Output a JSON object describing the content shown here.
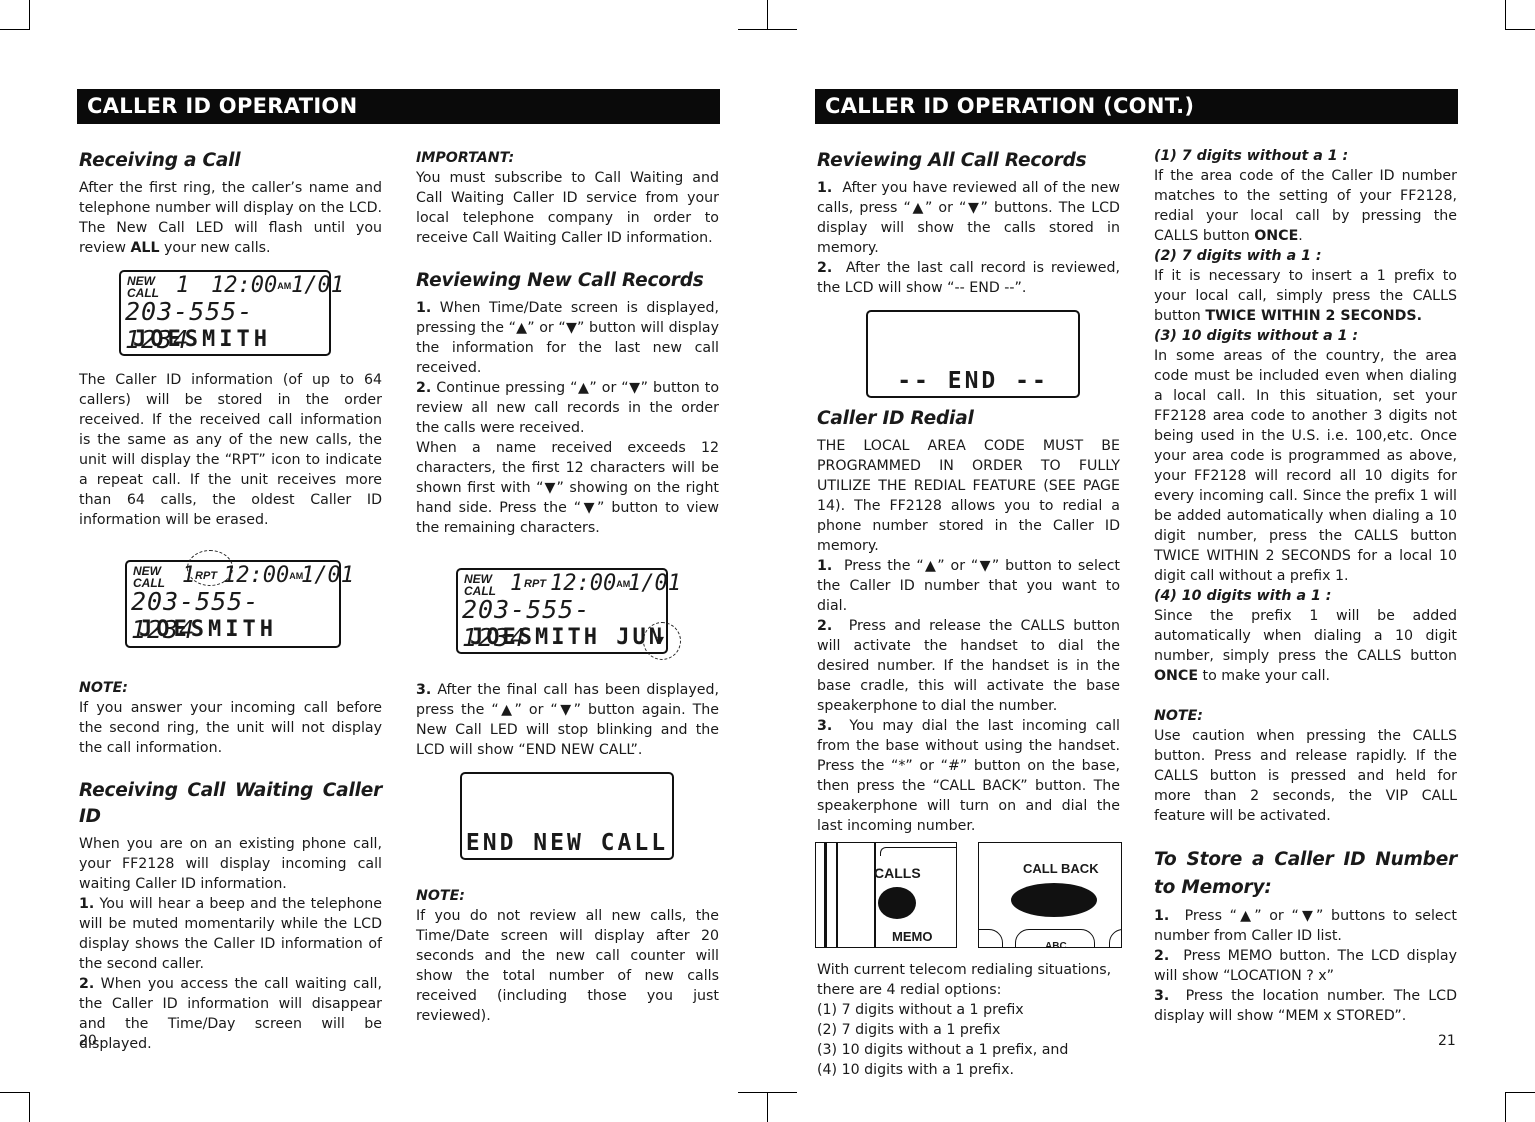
{
  "left_page": {
    "banner": "CALLER ID OPERATION",
    "page_number": "20",
    "col1": {
      "receiving_call": {
        "heading": "Receiving a Call",
        "p1_a": "After the first ring, the caller’s name and telephone number will display on the LCD. The New Call LED will flash until you review ",
        "p1_bold": "ALL",
        "p1_b": " your new calls.",
        "p2": "The Caller ID information (of up to 64 callers) will be stored in the order received. If the received call information is the same as any of the new calls, the unit will display the “RPT” icon to indicate a repeat call. If the unit receives more than 64 calls, the oldest Caller ID information will be erased."
      },
      "lcd1": {
        "new": "NEW",
        "call": "CALL",
        "count": "1",
        "time": "12:00",
        "ampm": "AM",
        "date": "1/01",
        "phone": "203-555- 1234",
        "name": "JOESMITH"
      },
      "lcd2": {
        "new": "NEW",
        "call": "CALL",
        "count": "1",
        "rpt": "RPT",
        "time": "12:00",
        "ampm": "AM",
        "date": "1/01",
        "phone": "203-555- 1234",
        "name": "JOESMITH"
      },
      "note": {
        "label": "NOTE:",
        "text": "If you answer your incoming call before the second ring, the unit will not display the call information."
      },
      "call_waiting": {
        "heading": "Receiving Call Waiting Caller ID",
        "intro": "When you are on an existing phone call, your FF2128 will display incoming call waiting Caller ID information.",
        "steps": [
          {
            "num": "1.",
            "text": "You will hear a beep and the telephone will be muted momentarily while the LCD display shows the Caller ID information of the second caller."
          },
          {
            "num": "2.",
            "text": "When you access the call waiting call, the Caller ID information will disappear and the Time/Day screen will be displayed."
          }
        ]
      }
    },
    "col2": {
      "important": {
        "label": "IMPORTANT:",
        "text": "You must subscribe to Call Waiting and Call Waiting Caller ID service from your local telephone company in order to receive Call Waiting Caller ID information."
      },
      "reviewing_new": {
        "heading": "Reviewing New Call Records",
        "step1_num": "1.",
        "step1": "When Time/Date screen is displayed, pressing the “▲” or “▼” button will display the information for the last new call received.",
        "step2_num": "2.",
        "step2": "Continue pressing “▲” or “▼” button to review all new call records in the order the calls were received.",
        "p_long": "When a name received exceeds 12 characters, the first 12 characters will be shown first with “▼” showing on the right hand side. Press the “▼” button to view the remaining characters.",
        "step3_num": "3.",
        "step3": "After the final call has been displayed, press the “▲” or “▼” button again. The New Call LED will stop blinking and the LCD will show “END NEW CALL”."
      },
      "lcd3": {
        "new": "NEW",
        "call": "CALL",
        "count": "1",
        "rpt": "RPT",
        "time": "12:00",
        "ampm": "AM",
        "date": "1/01",
        "phone": "203-555- 1234",
        "name": "JOESMITH JUN",
        "arrow": "▾"
      },
      "lcd4": {
        "text": "END NEW CALL"
      },
      "note": {
        "label": "NOTE:",
        "text": "If you do not review all new calls, the Time/Date screen will display after 20 seconds and the new call counter will show the total number of new calls received (including those you just reviewed)."
      }
    }
  },
  "right_page": {
    "banner": "CALLER ID OPERATION (CONT.)",
    "page_number": "21",
    "col3": {
      "reviewing_all": {
        "heading": "Reviewing All Call Records",
        "step1_num": "1.",
        "step1": "After you have reviewed all of the new calls, press “▲” or “▼” buttons. The LCD display will show the calls stored in memory.",
        "step2_num": "2.",
        "step2": "After the last call record is reviewed, the LCD will show “-- END --”."
      },
      "lcd5": {
        "text": "-- END --"
      },
      "redial": {
        "heading": "Caller ID Redial",
        "intro": "THE LOCAL AREA CODE MUST BE PROGRAMMED IN ORDER TO FULLY UTILIZE THE REDIAL FEATURE (SEE PAGE 14). The FF2128 allows you to redial a phone number stored in the Caller ID memory.",
        "steps": [
          {
            "num": "1.",
            "text": "Press the “▲” or “▼” button to select the Caller ID number that you want to dial."
          },
          {
            "num": "2.",
            "text": "Press and release the CALLS button will activate the handset to dial the desired number. If the handset is in the base cradle, this will activate the base speakerphone to dial the number."
          },
          {
            "num": "3.",
            "text": "You may dial the last incoming call from the base without using the handset. Press the “*” or “#” button on the base, then press the “CALL BACK” button. The speakerphone will turn on and dial the last incoming number."
          }
        ]
      },
      "fig_calls": {
        "calls": "CALLS",
        "memo": "MEMO"
      },
      "fig_callback": {
        "callback": "CALL BACK",
        "abc": "ABC"
      },
      "options_intro": "With current telecom redialing situations, there are 4 redial options:",
      "options": [
        "(1)  7 digits without a 1 prefix",
        "(2)  7 digits with a 1 prefix",
        "(3)  10 digits without a 1 prefix, and",
        "(4)  10 digits with a 1 prefix."
      ]
    },
    "col4": {
      "opt1": {
        "label": "(1)  7 digits without a 1 :",
        "text_a": "If the area code of the Caller ID number matches to the setting of your FF2128, redial your local call by pressing the CALLS button ",
        "bold": "ONCE",
        "text_b": "."
      },
      "opt2": {
        "label": "(2)  7 digits with a 1 :",
        "text_a": "If it is necessary to insert a 1 prefix to your local call, simply press the CALLS button ",
        "bold": "TWICE WITHIN 2 SECONDS."
      },
      "opt3": {
        "label": "(3)  10 digits without a 1 :",
        "text": "In some areas of the country, the area code must be included even when dialing a local call. In this situation, set your FF2128 area code to another 3 digits not being used in the U.S. i.e. 100,etc. Once your area code is programmed as above, your FF2128 will record all 10 digits for every incoming call. Since the prefix 1 will be added automatically when dialing a 10 digit number, press the CALLS button TWICE WITHIN 2 SECONDS for a local 10 digit call without a prefix 1."
      },
      "opt4": {
        "label": "(4)  10 digits with a 1 :",
        "text_a": "Since the prefix 1 will be added automatically when dialing a 10 digit number, simply press the CALLS button ",
        "bold": "ONCE",
        "text_b": " to make your call."
      },
      "note": {
        "label": "NOTE:",
        "text": "Use caution when pressing the CALLS button. Press and release rapidly. If the CALLS button is pressed and held for more than 2 seconds, the VIP CALL feature will be activated."
      },
      "store": {
        "heading": "To Store a Caller ID Number to Memory:",
        "steps": [
          {
            "num": "1.",
            "text": "Press “▲” or “▼” buttons to select number from Caller ID list."
          },
          {
            "num": "2.",
            "text": "Press MEMO button. The LCD display will show “LOCATION ? x”"
          },
          {
            "num": "3.",
            "text": "Press the location number. The LCD display will show “MEM x STORED”."
          }
        ]
      }
    }
  }
}
